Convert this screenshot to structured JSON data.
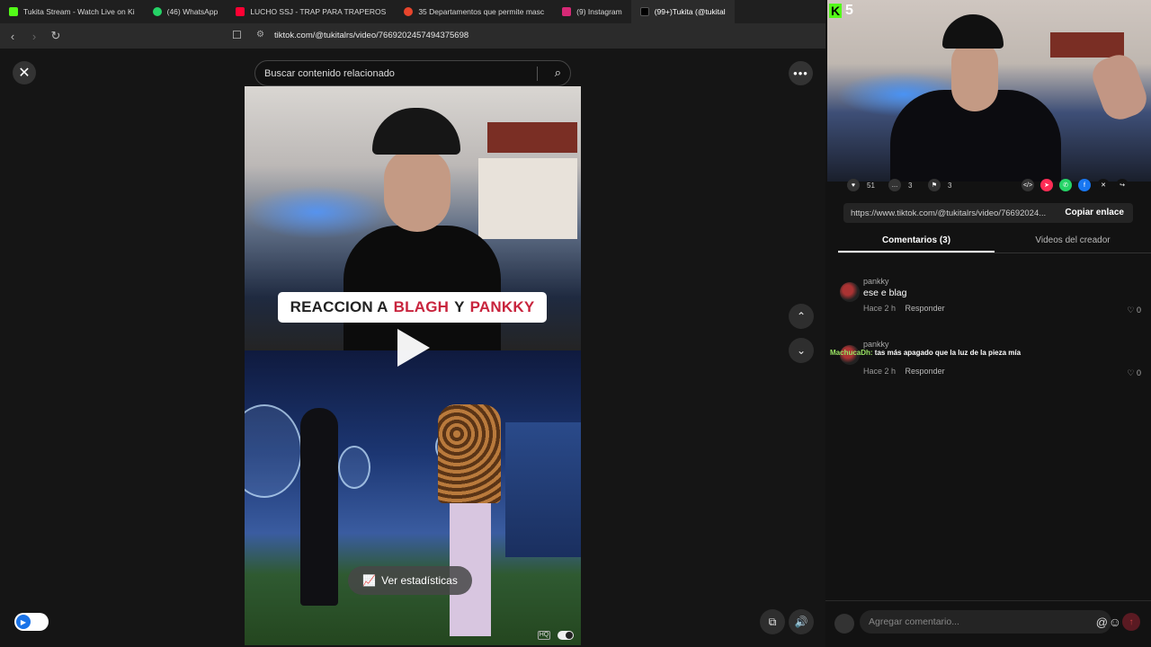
{
  "browser": {
    "tabs": [
      {
        "label": "Tukita Stream - Watch Live on Ki",
        "color": "#53fc18"
      },
      {
        "label": "(46) WhatsApp",
        "color": "#25d366"
      },
      {
        "label": "LUCHO SSJ - TRAP PARA TRAPEROS",
        "color": "#ff0033"
      },
      {
        "label": "35 Departamentos que permite masc",
        "color": "#e8452c"
      },
      {
        "label": "(9) Instagram",
        "color": "#d62976"
      },
      {
        "label": "(99+)Tukita (@tukital",
        "color": "#000000"
      }
    ],
    "url": "tiktok.com/@tukitalrs/video/7669202457494375698"
  },
  "viewer": {
    "search_placeholder": "Buscar contenido relacionado",
    "caption_parts": [
      "REACCION A",
      "BLAGH",
      "Y",
      "PANKKY"
    ],
    "stats_label": "Ver estadísticas"
  },
  "stream": {
    "platform_badge": "K",
    "viewer_count": "5",
    "chat_user": "MachucaDh:",
    "chat_message": "tas más apagado que la luz de la pieza mía"
  },
  "actions": {
    "likes": "51",
    "comments": "3",
    "saves": "3"
  },
  "share": {
    "link": "https://www.tiktok.com/@tukitalrs/video/76692024...",
    "copy_label": "Copiar enlace"
  },
  "panel_tabs": [
    "Comentarios (3)",
    "Videos del creador"
  ],
  "comments": [
    {
      "user": "pankky",
      "text": "ese e blag",
      "time": "Hace 2 h",
      "reply": "Responder",
      "likes": "0"
    },
    {
      "user": "pankky",
      "text": "",
      "time": "Hace 2 h",
      "reply": "Responder",
      "likes": "0"
    }
  ],
  "composer": {
    "placeholder": "Agregar comentario..."
  },
  "colors": {
    "kick_green": "#53fc18",
    "caption_red": "#c8243d",
    "send_red": "#5a1a22"
  }
}
